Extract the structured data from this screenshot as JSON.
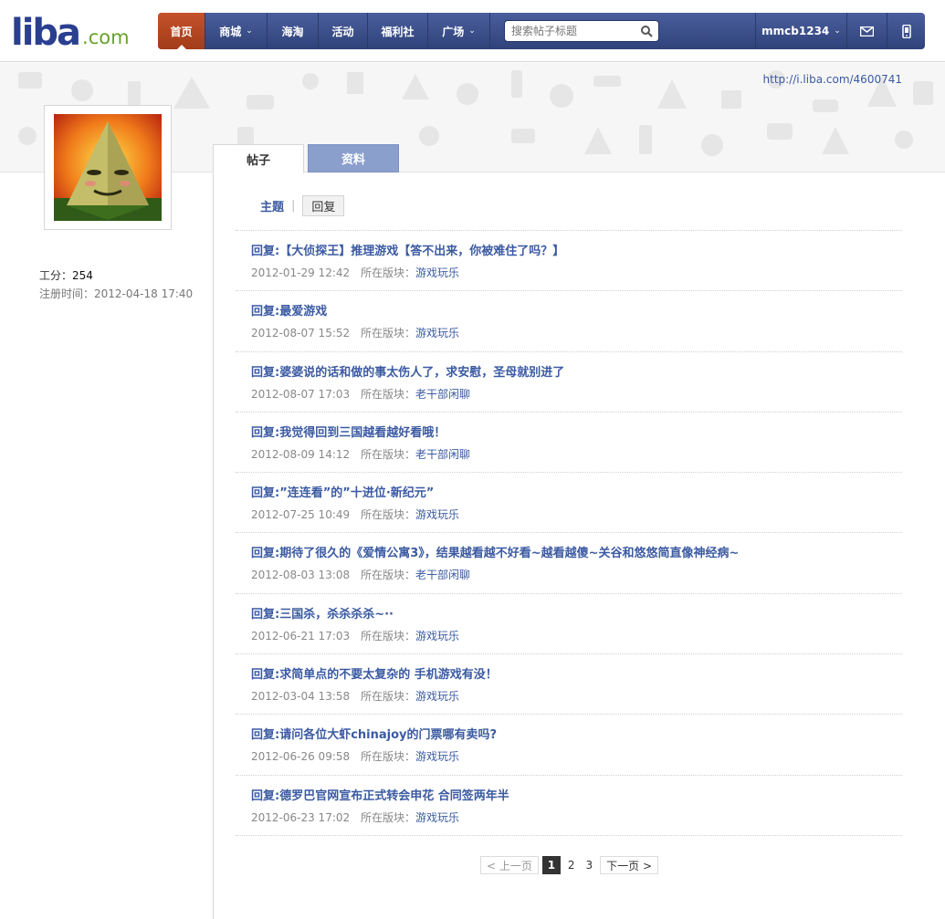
{
  "logo": {
    "main": "liba",
    "suffix": ".com"
  },
  "nav": {
    "items": [
      {
        "label": "首页",
        "active": true,
        "dropdown": false
      },
      {
        "label": "商城",
        "active": false,
        "dropdown": true
      },
      {
        "label": "海淘",
        "active": false,
        "dropdown": false
      },
      {
        "label": "活动",
        "active": false,
        "dropdown": false
      },
      {
        "label": "福利社",
        "active": false,
        "dropdown": false
      },
      {
        "label": "广场",
        "active": false,
        "dropdown": true
      }
    ],
    "search_placeholder": "搜索帖子标题",
    "username": "mmcb1234"
  },
  "profile": {
    "url": "http://i.liba.com/4600741",
    "points_label": "工分：",
    "points_value": "254",
    "register_label": "注册时间：",
    "register_value": "2012-04-18 17:40"
  },
  "tabs": {
    "posts": "帖子",
    "info": "资料"
  },
  "subtabs": {
    "topics": "主题",
    "replies": "回复"
  },
  "meta_label": "所在版块：",
  "posts": [
    {
      "title": "回复:【大侦探王】推理游戏【答不出来，你被难住了吗？】",
      "date": "2012-01-29 12:42",
      "forum": "游戏玩乐"
    },
    {
      "title": "回复:最爱游戏",
      "date": "2012-08-07 15:52",
      "forum": "游戏玩乐"
    },
    {
      "title": "回复:婆婆说的话和做的事太伤人了，求安慰，圣母就别进了",
      "date": "2012-08-07 17:03",
      "forum": "老干部闲聊"
    },
    {
      "title": "回复:我觉得回到三国越看越好看哦！",
      "date": "2012-08-09 14:12",
      "forum": "老干部闲聊"
    },
    {
      "title": "回复:”连连看”的”十进位·新纪元”",
      "date": "2012-07-25 10:49",
      "forum": "游戏玩乐"
    },
    {
      "title": "回复:期待了很久的《爱情公寓3》，结果越看越不好看~越看越傻~关谷和悠悠简直像神经病~",
      "date": "2012-08-03 13:08",
      "forum": "老干部闲聊"
    },
    {
      "title": "回复:三国杀，杀杀杀杀~··",
      "date": "2012-06-21 17:03",
      "forum": "游戏玩乐"
    },
    {
      "title": "回复:求简单点的不要太复杂的 手机游戏有没！",
      "date": "2012-03-04 13:58",
      "forum": "游戏玩乐"
    },
    {
      "title": "回复:请问各位大虾chinajoy的门票哪有卖吗?",
      "date": "2012-06-26 09:58",
      "forum": "游戏玩乐"
    },
    {
      "title": "回复:德罗巴官网宣布正式转会申花 合同签两年半",
      "date": "2012-06-23 17:02",
      "forum": "游戏玩乐"
    }
  ],
  "pager": {
    "prev": "< 上一页",
    "pages": [
      "1",
      "2",
      "3"
    ],
    "current": "1",
    "next": "下一页 >"
  },
  "colors": {
    "nav": "#334783",
    "nav_active": "#b2431f",
    "link": "#3b5aa2",
    "tab_inactive": "#8b9fcd"
  }
}
